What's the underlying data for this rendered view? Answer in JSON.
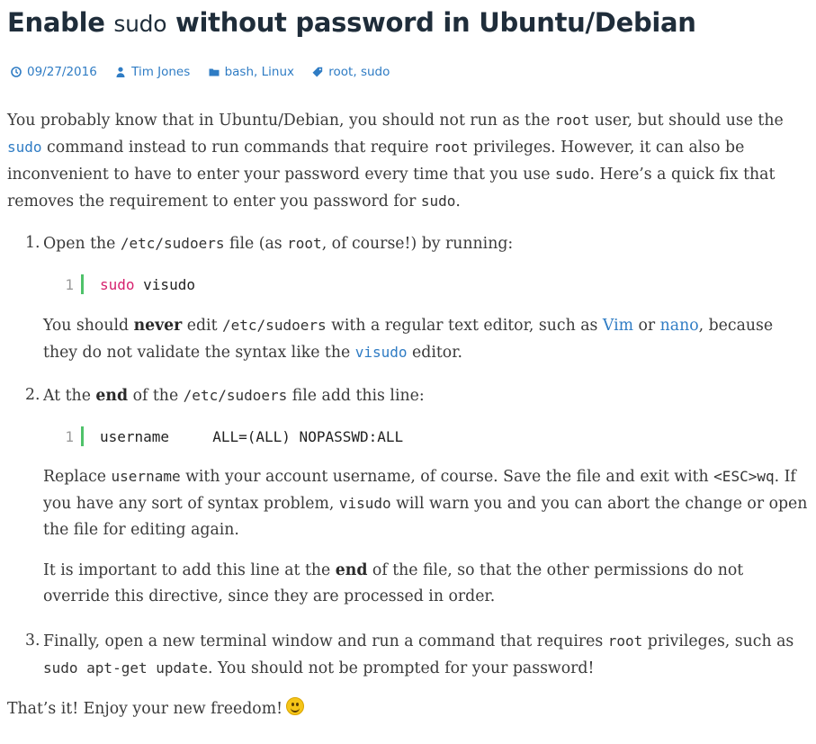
{
  "title": {
    "part1": "Enable ",
    "part2": "sudo",
    "part3": " without password in Ubuntu/Debian"
  },
  "meta": {
    "date": "09/27/2016",
    "author": "Tim Jones",
    "cat1": "bash",
    "cat2": "Linux",
    "tag1": "root",
    "tag2": "sudo"
  },
  "intro": {
    "t1": "You probably know that in Ubuntu/Debian, you should not run as the ",
    "c1": "root",
    "t2": " user, but should use the ",
    "l1": "sudo",
    "t3": " command instead to run commands that require ",
    "c2": "root",
    "t4": " privileges. However, it can also be inconvenient to have to enter your password every time that you use ",
    "c3": "sudo",
    "t5": ". Here’s a quick fix that removes the requirement to enter you password for ",
    "c4": "sudo",
    "t6": "."
  },
  "step1": {
    "num": "1.",
    "t1": "Open the ",
    "c1": "/etc/sudoers",
    "t2": " file (as ",
    "c2": "root",
    "t3": ", of course!) by running:",
    "code_ln": "1",
    "code_kw": "sudo",
    "code_rest": " visudo",
    "n1": "You should ",
    "nb": "never",
    "n2": " edit ",
    "nc": "/etc/sudoers",
    "n3": " with a regular text editor, such as ",
    "nl1": "Vim",
    "n4": " or ",
    "nl2": "nano",
    "n5": ", because they do not validate the syntax like the ",
    "nl3": "visudo",
    "n6": " editor."
  },
  "step2": {
    "num": "2.",
    "t1": "At the ",
    "b1": "end",
    "t2": " of the ",
    "c1": "/etc/sudoers",
    "t3": " file add this line:",
    "code_ln": "1",
    "code_line": "username     ALL=(ALL) NOPASSWD:ALL",
    "r1": "Replace ",
    "rc1": "username",
    "r2": " with your account username, of course. Save the file and exit with ",
    "rc2": "<ESC>wq",
    "r3": ". If you have any sort of syntax problem, ",
    "rc3": "visudo",
    "r4": " will warn you and you can abort the change or open the file for editing again.",
    "i1": "It is important to add this line at the ",
    "ib": "end",
    "i2": " of the file, so that the other permissions do not override this directive, since they are processed in order."
  },
  "step3": {
    "num": "3.",
    "t1": "Finally, open a new terminal window and run a command that requires ",
    "c1": "root",
    "t2": " privileges, such as ",
    "c2": "sudo apt-get update",
    "t3": ". You should not be prompted for your password!"
  },
  "outro": {
    "text": "That’s it! Enjoy your new freedom!"
  },
  "colors": {
    "link": "#2f7cc4",
    "keyword": "#d6226f",
    "gutter": "#4fc26a",
    "heading": "#1f2d3a"
  },
  "icons": [
    "clock-icon",
    "user-icon",
    "folder-icon",
    "tag-icon",
    "smiley-icon"
  ]
}
